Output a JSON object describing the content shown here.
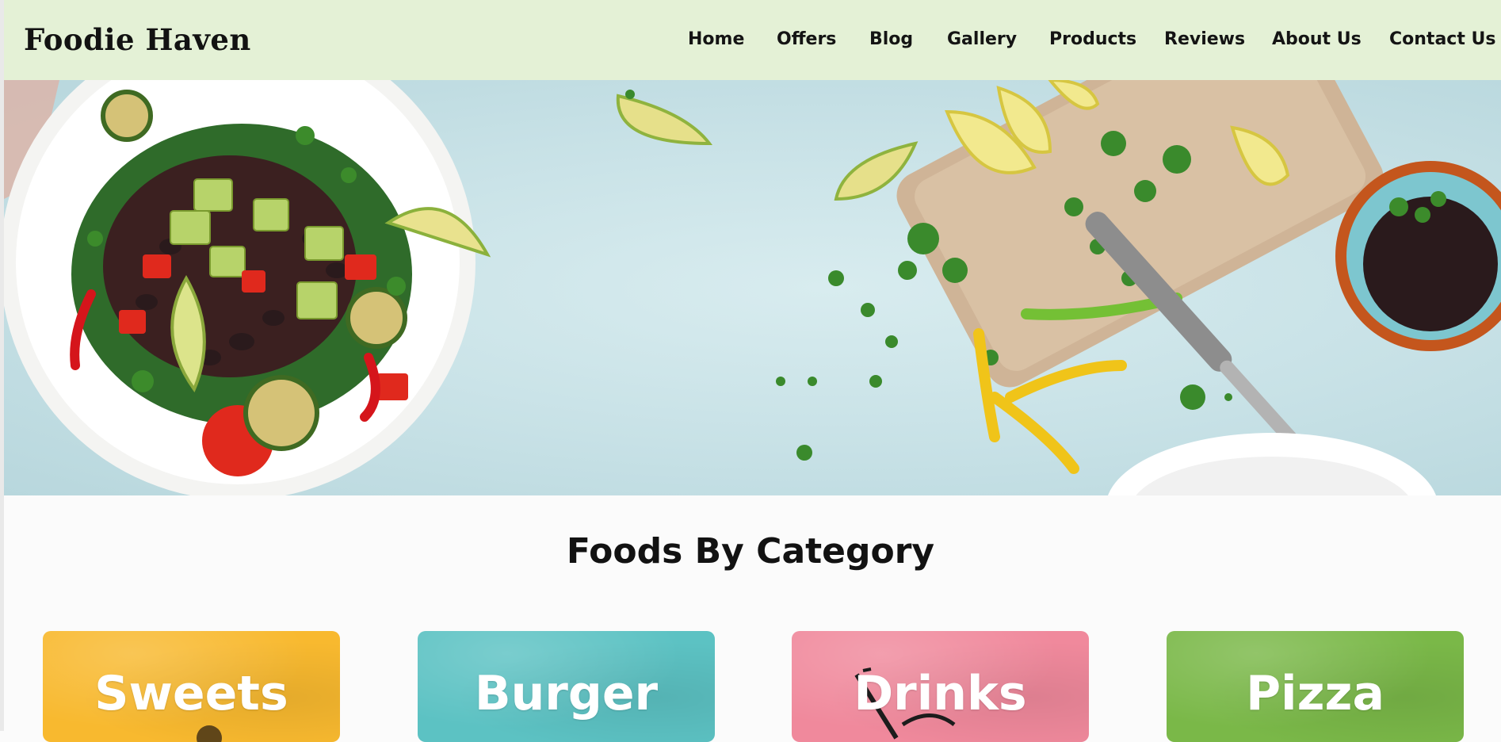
{
  "header": {
    "logo": "Foodie Haven",
    "nav": [
      {
        "label": "Home"
      },
      {
        "label": "Offers"
      },
      {
        "label": "Blog"
      },
      {
        "label": "Gallery"
      },
      {
        "label": "Products"
      },
      {
        "label": "Reviews"
      },
      {
        "label": "About Us"
      },
      {
        "label": "Contact Us"
      }
    ],
    "background": "#e4f1d6"
  },
  "section": {
    "title": "Foods By Category"
  },
  "categories": [
    {
      "label": "Sweets",
      "color": "#f8b92f"
    },
    {
      "label": "Burger",
      "color": "#5cc2c3"
    },
    {
      "label": "Drinks",
      "color": "#f0899c"
    },
    {
      "label": "Pizza",
      "color": "#7ab848"
    }
  ]
}
